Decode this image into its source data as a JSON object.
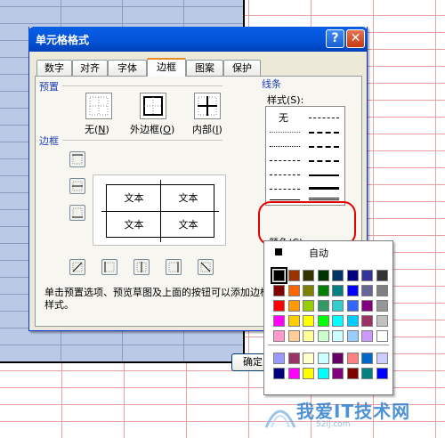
{
  "dialog": {
    "title": "单元格格式",
    "help_glyph": "?",
    "close_glyph": "✕",
    "ok_label": "确定"
  },
  "tabs": [
    "数字",
    "对齐",
    "字体",
    "边框",
    "图案",
    "保护"
  ],
  "active_tab": "边框",
  "presets": {
    "group_label": "预置",
    "items": [
      {
        "label": "无",
        "hotkey": "N",
        "icon": "no-border-icon"
      },
      {
        "label": "外边框",
        "hotkey": "O",
        "icon": "outline-border-icon"
      },
      {
        "label": "内部",
        "hotkey": "I",
        "icon": "inside-border-icon"
      }
    ]
  },
  "border": {
    "group_label": "边框",
    "preview_texts": [
      "文本",
      "文本",
      "文本",
      "文本"
    ],
    "instruction": "单击预置选项、预览草图及上面的按钮可以添加边框样式。",
    "side_buttons": [
      "top-border-icon",
      "middle-horizontal-border-icon",
      "bottom-border-icon"
    ],
    "bottom_buttons": [
      "diagonal-up-border-icon",
      "left-border-icon",
      "middle-vertical-border-icon",
      "right-border-icon",
      "diagonal-down-border-icon"
    ]
  },
  "line": {
    "group_label": "线条",
    "style_label": "样式(S):",
    "none_label": "无",
    "color_label": "颜色(C):",
    "color_value": "#000000"
  },
  "palette": {
    "auto_label": "自动",
    "rows": [
      [
        "#000000",
        "#993300",
        "#333300",
        "#003300",
        "#003366",
        "#000080",
        "#333399",
        "#333333"
      ],
      [
        "#800000",
        "#FF6600",
        "#808000",
        "#008000",
        "#008080",
        "#0000FF",
        "#666699",
        "#808080"
      ],
      [
        "#FF0000",
        "#FF9900",
        "#99CC00",
        "#339966",
        "#33CCCC",
        "#3366FF",
        "#800080",
        "#969696"
      ],
      [
        "#FF00FF",
        "#FFCC00",
        "#FFFF00",
        "#00FF00",
        "#00FFFF",
        "#00CCFF",
        "#993366",
        "#C0C0C0"
      ],
      [
        "#FF99CC",
        "#FFCC99",
        "#FFFF99",
        "#CCFFCC",
        "#CCFFFF",
        "#99CCFF",
        "#CC99FF",
        "#FFFFFF"
      ]
    ],
    "extra_rows": [
      [
        "#9999FF",
        "#993366",
        "#FFFFCC",
        "#CCFFFF",
        "#660066",
        "#FF8080",
        "#0066CC",
        "#CCCCFF"
      ],
      [
        "#000080",
        "#FF00FF",
        "#FFFF00",
        "#00FFFF",
        "#800080",
        "#800000",
        "#008080",
        "#0000FF"
      ]
    ],
    "selected_color": "#000000"
  },
  "watermark": {
    "main": "我爱IT技术网",
    "sub": "52ij.com"
  }
}
